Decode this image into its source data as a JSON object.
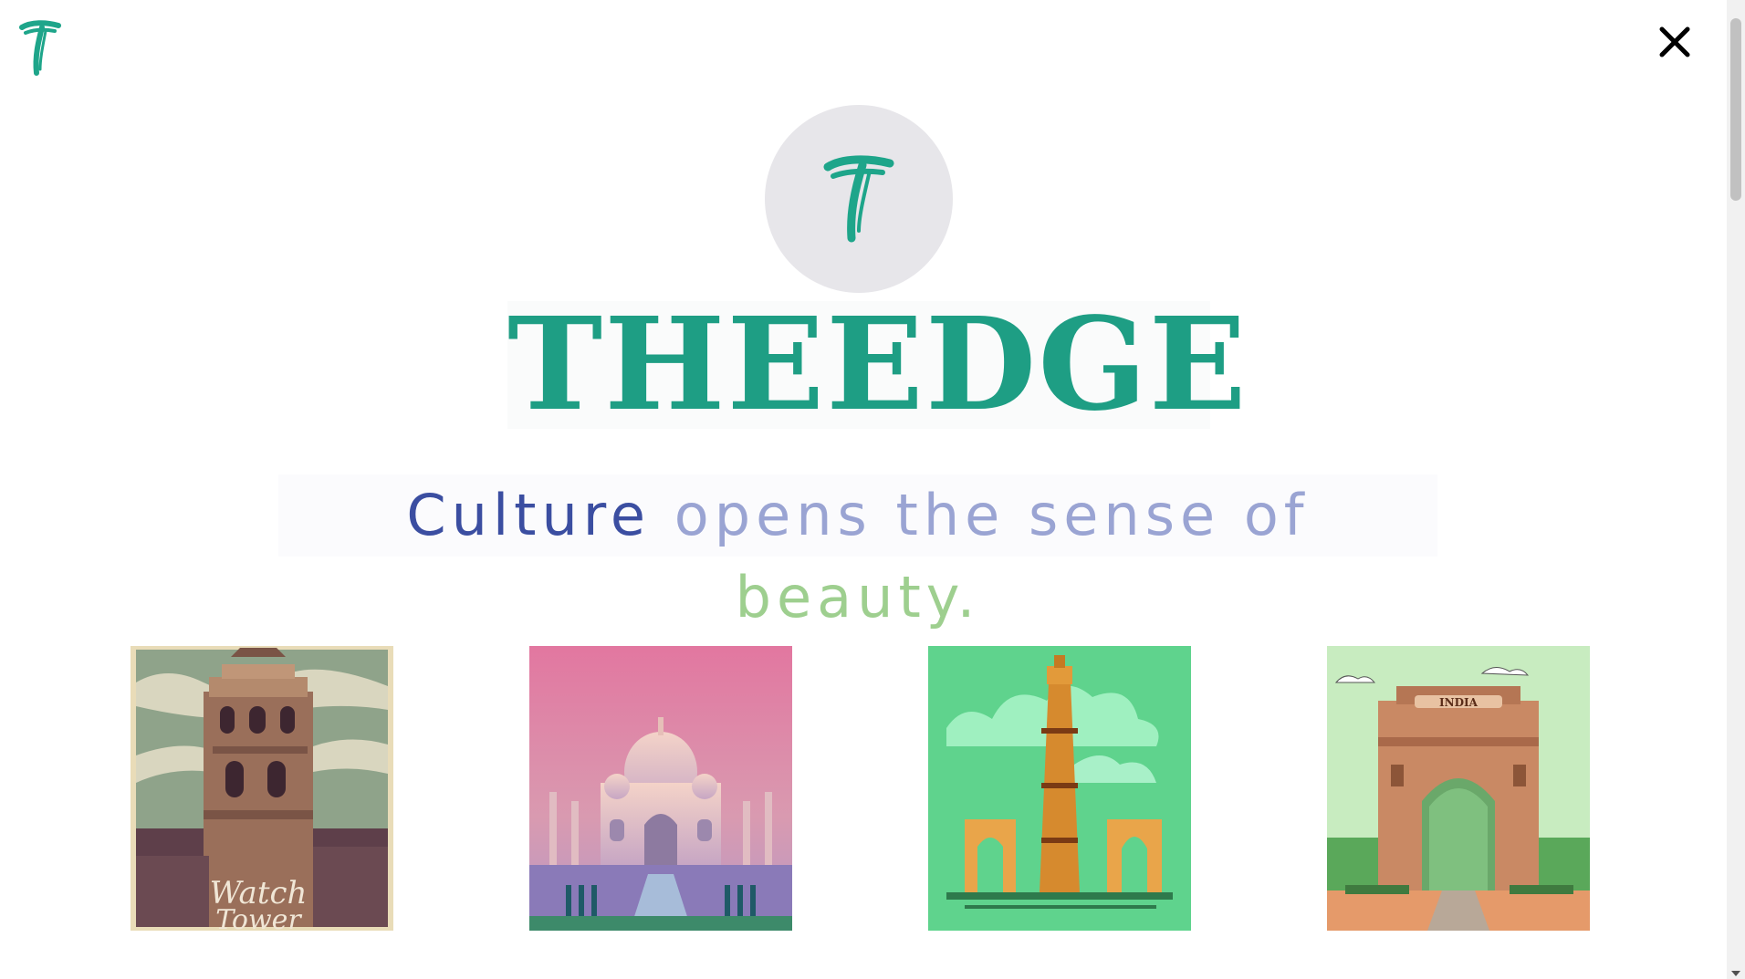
{
  "brand": {
    "name": "THEEDGE",
    "logo_letter": "T",
    "color": "#1e9e84"
  },
  "tagline": {
    "word1": "Culture",
    "word2": "opens the sense of",
    "word3": "beauty."
  },
  "header": {
    "close_label": "✕"
  },
  "gallery": {
    "items": [
      {
        "name": "watch-tower",
        "caption": "Watch Tower"
      },
      {
        "name": "taj-mahal"
      },
      {
        "name": "qutub-minar"
      },
      {
        "name": "india-gate",
        "caption": "INDIA"
      }
    ]
  },
  "colors": {
    "accent": "#1e9e84",
    "tagline_dark": "#3b4ea1",
    "tagline_light": "#9aa4d3",
    "tagline_green": "#9ecf8f"
  },
  "icons": {
    "corner": "brand-t-icon",
    "close": "close-icon"
  }
}
